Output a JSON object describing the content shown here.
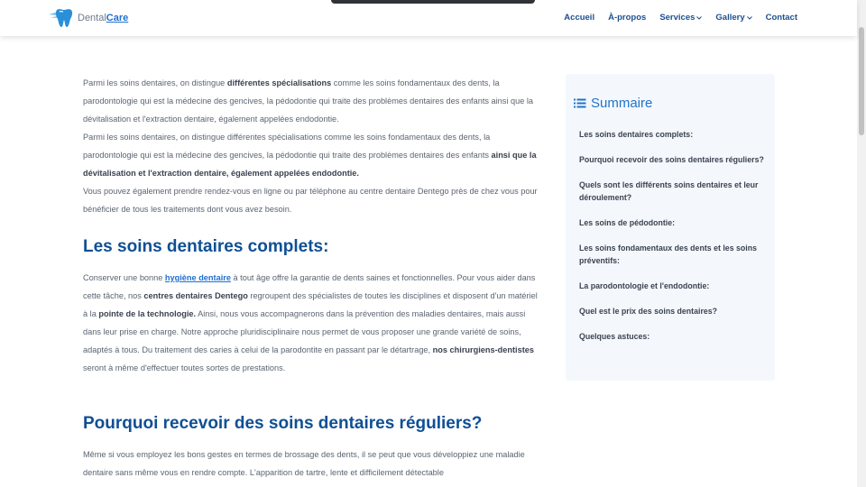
{
  "header": {
    "logo_prefix": "Dental",
    "logo_suffix": "Care",
    "nav": [
      {
        "label": "Accueil",
        "dropdown": false
      },
      {
        "label": "À-propos",
        "dropdown": false
      },
      {
        "label": "Services",
        "dropdown": true
      },
      {
        "label": "Gallery",
        "dropdown": true
      },
      {
        "label": "Contact",
        "dropdown": false
      }
    ]
  },
  "intro": {
    "p1_a": "Parmi les soins dentaires, on distingue ",
    "p1_b": "différentes spécialisations",
    "p1_c": " comme les soins fondamentaux des dents, la parodontologie qui est la médecine des gencives, la pédodontie qui traite des problèmes dentaires des enfants ainsi que la dévitalisation et l'extraction dentaire, également appelées endodontie.",
    "p2_a": "Parmi les soins dentaires, on distingue différentes spécialisations comme les soins fondamentaux des dents, la parodontologie qui est la médecine des gencives, la pédodontie qui traite des problèmes dentaires des enfants ",
    "p2_b": "ainsi que la dévitalisation et l'extraction dentaire, également appelées endodontie.",
    "p3": "Vous pouvez également prendre rendez-vous en ligne ou par téléphone au centre dentaire Dentego près de chez vous pour bénéficier de tous les traitements dont vous avez besoin."
  },
  "section_complets": {
    "title": "Les soins dentaires complets:",
    "t1": "Conserver une bonne ",
    "link": "hygiène dentaire",
    "t2": " à tout âge offre la garantie de dents saines et fonctionnelles. Pour vous aider dans cette tâche, nos ",
    "b1": "centres dentaires Dentego",
    "t3": " regroupent des spécialistes de toutes les disciplines et disposent d'un matériel à la ",
    "b2": "pointe de la technologie.",
    "t4": " Ainsi, nous vous accompagnerons dans la prévention des maladies dentaires, mais aussi dans leur prise en charge. Notre approche pluridisciplinaire nous permet de vous proposer une grande variété de soins, adaptés à tous. Du traitement des caries à celui de la parodontite en passant par le détartrage, ",
    "b3": "nos chirurgiens-dentistes",
    "t5": " seront à même d'effectuer toutes sortes de prestations."
  },
  "section_reguliers": {
    "title": "Pourquoi recevoir des soins dentaires réguliers?",
    "text": "Même si vous employez les bons gestes en termes de brossage des dents, il se peut que vous développiez une maladie dentaire sans même vous en rendre compte. L'apparition de tartre, lente et difficilement détectable"
  },
  "summary": {
    "title": "Summaire",
    "items": [
      "Les soins dentaires complets:",
      "Pourquoi recevoir des soins dentaires réguliers?",
      "Quels sont les différents soins dentaires et leur déroulement?",
      "Les soins de pédodontie:",
      "Les soins fondamentaux des dents et les soins préventifs:",
      "La parodontologie et l'endodontie:",
      "Quel est le prix des soins dentaires?",
      "Quelques astuces:"
    ]
  },
  "colors": {
    "heading": "#0f4f94",
    "accent": "#1f74c9",
    "nav": "#1c4f8f",
    "sidebar_bg": "#f4f8fd"
  }
}
